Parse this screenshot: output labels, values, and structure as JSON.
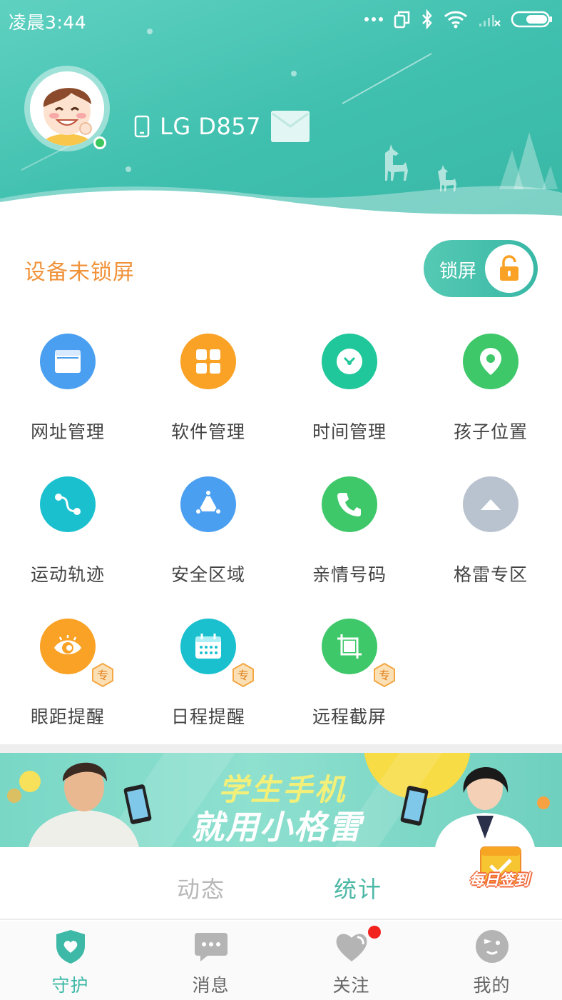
{
  "status_bar": {
    "time": "凌晨3:44"
  },
  "header": {
    "device_name": "LG D857"
  },
  "lock": {
    "status": "设备未锁屏",
    "toggle_label": "锁屏"
  },
  "features": [
    {
      "label": "网址管理",
      "icon": "browser-icon",
      "color": "#4a9ff0"
    },
    {
      "label": "软件管理",
      "icon": "apps-icon",
      "color": "#f9a225"
    },
    {
      "label": "时间管理",
      "icon": "clock-icon",
      "color": "#1fc79a"
    },
    {
      "label": "孩子位置",
      "icon": "location-pin-icon",
      "color": "#3fc86a"
    },
    {
      "label": "运动轨迹",
      "icon": "route-icon",
      "color": "#1bc0cf"
    },
    {
      "label": "安全区域",
      "icon": "safe-zone-icon",
      "color": "#4a9ff0"
    },
    {
      "label": "亲情号码",
      "icon": "phone-icon",
      "color": "#3fc86a"
    },
    {
      "label": "格雷专区",
      "icon": "chevron-up-icon",
      "color": "#b9c3cf"
    },
    {
      "label": "眼距提醒",
      "icon": "eye-icon",
      "color": "#f9a225",
      "badge": "专"
    },
    {
      "label": "日程提醒",
      "icon": "calendar-icon",
      "color": "#1bc0cf",
      "badge": "专"
    },
    {
      "label": "远程截屏",
      "icon": "screenshot-icon",
      "color": "#3fc86a",
      "badge": "专"
    }
  ],
  "banner": {
    "line1": "学生手机",
    "line2": "就用小格雷"
  },
  "tabs": [
    {
      "label": "动态",
      "active": false
    },
    {
      "label": "统计",
      "active": true
    }
  ],
  "checkin": {
    "label": "每日签到"
  },
  "bottom_nav": [
    {
      "label": "守护",
      "icon": "shield-heart-icon",
      "active": true
    },
    {
      "label": "消息",
      "icon": "chat-bubble-icon",
      "active": false
    },
    {
      "label": "关注",
      "icon": "heart-icon",
      "active": false,
      "notification": true
    },
    {
      "label": "我的",
      "icon": "face-icon",
      "active": false
    }
  ],
  "colors": {
    "accent": "#3fb9a7",
    "warning": "#f0923a",
    "notification": "#f2231f"
  }
}
